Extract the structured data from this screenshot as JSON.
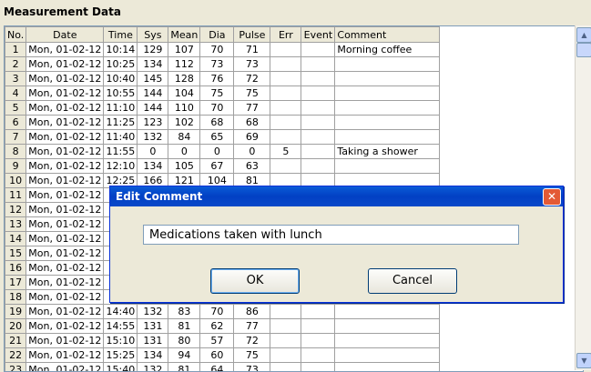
{
  "panel": {
    "title": "Measurement Data"
  },
  "columns": [
    "No.",
    "Date",
    "Time",
    "Sys",
    "Mean",
    "Dia",
    "Pulse",
    "Err",
    "Event",
    "Comment"
  ],
  "rows": [
    {
      "no": "1",
      "date": "Mon, 01-02-12",
      "time": "10:14",
      "sys": "129",
      "mean": "107",
      "dia": "70",
      "pulse": "71",
      "err": "",
      "event": "",
      "comment": "Morning coffee"
    },
    {
      "no": "2",
      "date": "Mon, 01-02-12",
      "time": "10:25",
      "sys": "134",
      "mean": "112",
      "dia": "73",
      "pulse": "73",
      "err": "",
      "event": "",
      "comment": ""
    },
    {
      "no": "3",
      "date": "Mon, 01-02-12",
      "time": "10:40",
      "sys": "145",
      "mean": "128",
      "dia": "76",
      "pulse": "72",
      "err": "",
      "event": "",
      "comment": ""
    },
    {
      "no": "4",
      "date": "Mon, 01-02-12",
      "time": "10:55",
      "sys": "144",
      "mean": "104",
      "dia": "75",
      "pulse": "75",
      "err": "",
      "event": "",
      "comment": ""
    },
    {
      "no": "5",
      "date": "Mon, 01-02-12",
      "time": "11:10",
      "sys": "144",
      "mean": "110",
      "dia": "70",
      "pulse": "77",
      "err": "",
      "event": "",
      "comment": ""
    },
    {
      "no": "6",
      "date": "Mon, 01-02-12",
      "time": "11:25",
      "sys": "123",
      "mean": "102",
      "dia": "68",
      "pulse": "68",
      "err": "",
      "event": "",
      "comment": ""
    },
    {
      "no": "7",
      "date": "Mon, 01-02-12",
      "time": "11:40",
      "sys": "132",
      "mean": "84",
      "dia": "65",
      "pulse": "69",
      "err": "",
      "event": "",
      "comment": ""
    },
    {
      "no": "8",
      "date": "Mon, 01-02-12",
      "time": "11:55",
      "sys": "0",
      "mean": "0",
      "dia": "0",
      "pulse": "0",
      "err": "5",
      "event": "",
      "comment": "Taking a shower"
    },
    {
      "no": "9",
      "date": "Mon, 01-02-12",
      "time": "12:10",
      "sys": "134",
      "mean": "105",
      "dia": "67",
      "pulse": "63",
      "err": "",
      "event": "",
      "comment": ""
    },
    {
      "no": "10",
      "date": "Mon, 01-02-12",
      "time": "12:25",
      "sys": "166",
      "mean": "121",
      "dia": "104",
      "pulse": "81",
      "err": "",
      "event": "",
      "comment": ""
    },
    {
      "no": "11",
      "date": "Mon, 01-02-12",
      "time": "",
      "sys": "",
      "mean": "",
      "dia": "",
      "pulse": "",
      "err": "",
      "event": "",
      "comment": ""
    },
    {
      "no": "12",
      "date": "Mon, 01-02-12",
      "time": "",
      "sys": "",
      "mean": "",
      "dia": "",
      "pulse": "",
      "err": "",
      "event": "",
      "comment": ""
    },
    {
      "no": "13",
      "date": "Mon, 01-02-12",
      "time": "",
      "sys": "",
      "mean": "",
      "dia": "",
      "pulse": "",
      "err": "",
      "event": "",
      "comment": ""
    },
    {
      "no": "14",
      "date": "Mon, 01-02-12",
      "time": "",
      "sys": "",
      "mean": "",
      "dia": "",
      "pulse": "",
      "err": "",
      "event": "",
      "comment": ""
    },
    {
      "no": "15",
      "date": "Mon, 01-02-12",
      "time": "",
      "sys": "",
      "mean": "",
      "dia": "",
      "pulse": "",
      "err": "",
      "event": "",
      "comment": ""
    },
    {
      "no": "16",
      "date": "Mon, 01-02-12",
      "time": "",
      "sys": "",
      "mean": "",
      "dia": "",
      "pulse": "",
      "err": "",
      "event": "",
      "comment": ""
    },
    {
      "no": "17",
      "date": "Mon, 01-02-12",
      "time": "",
      "sys": "",
      "mean": "",
      "dia": "",
      "pulse": "",
      "err": "",
      "event": "",
      "comment": ""
    },
    {
      "no": "18",
      "date": "Mon, 01-02-12",
      "time": "",
      "sys": "",
      "mean": "",
      "dia": "",
      "pulse": "",
      "err": "",
      "event": "",
      "comment": ""
    },
    {
      "no": "19",
      "date": "Mon, 01-02-12",
      "time": "14:40",
      "sys": "132",
      "mean": "83",
      "dia": "70",
      "pulse": "86",
      "err": "",
      "event": "",
      "comment": ""
    },
    {
      "no": "20",
      "date": "Mon, 01-02-12",
      "time": "14:55",
      "sys": "131",
      "mean": "81",
      "dia": "62",
      "pulse": "77",
      "err": "",
      "event": "",
      "comment": ""
    },
    {
      "no": "21",
      "date": "Mon, 01-02-12",
      "time": "15:10",
      "sys": "131",
      "mean": "80",
      "dia": "57",
      "pulse": "72",
      "err": "",
      "event": "",
      "comment": ""
    },
    {
      "no": "22",
      "date": "Mon, 01-02-12",
      "time": "15:25",
      "sys": "134",
      "mean": "94",
      "dia": "60",
      "pulse": "75",
      "err": "",
      "event": "",
      "comment": ""
    },
    {
      "no": "23",
      "date": "Mon, 01-02-12",
      "time": "15:40",
      "sys": "132",
      "mean": "81",
      "dia": "64",
      "pulse": "73",
      "err": "",
      "event": "",
      "comment": ""
    }
  ],
  "dialog": {
    "title": "Edit Comment",
    "close_label": "✕",
    "input_value": "Medications taken with lunch",
    "ok_label": "OK",
    "cancel_label": "Cancel"
  },
  "scrollbar": {
    "up_icon": "▲",
    "down_icon": "▼"
  }
}
